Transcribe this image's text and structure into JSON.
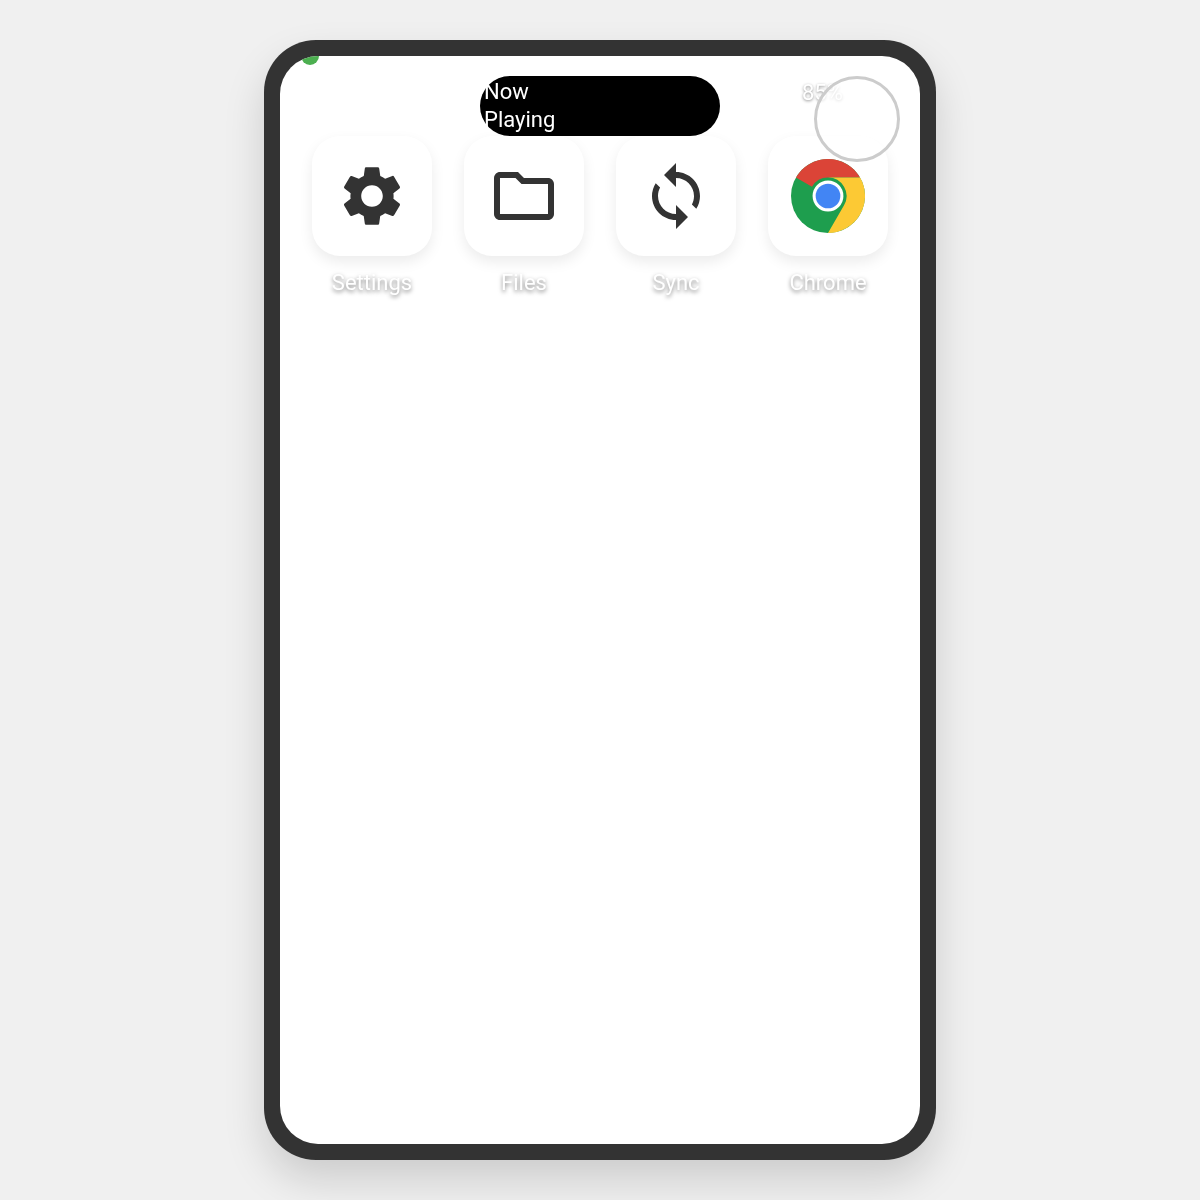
{
  "dynamic_island": {
    "text": "Now Playing"
  },
  "status_bar": {
    "battery": "85%"
  },
  "apps": [
    {
      "label": "Settings",
      "kind": "settings"
    },
    {
      "label": "Files",
      "kind": "files"
    },
    {
      "label": "Sync",
      "kind": "sync"
    },
    {
      "label": "Chrome",
      "kind": "chrome"
    }
  ]
}
